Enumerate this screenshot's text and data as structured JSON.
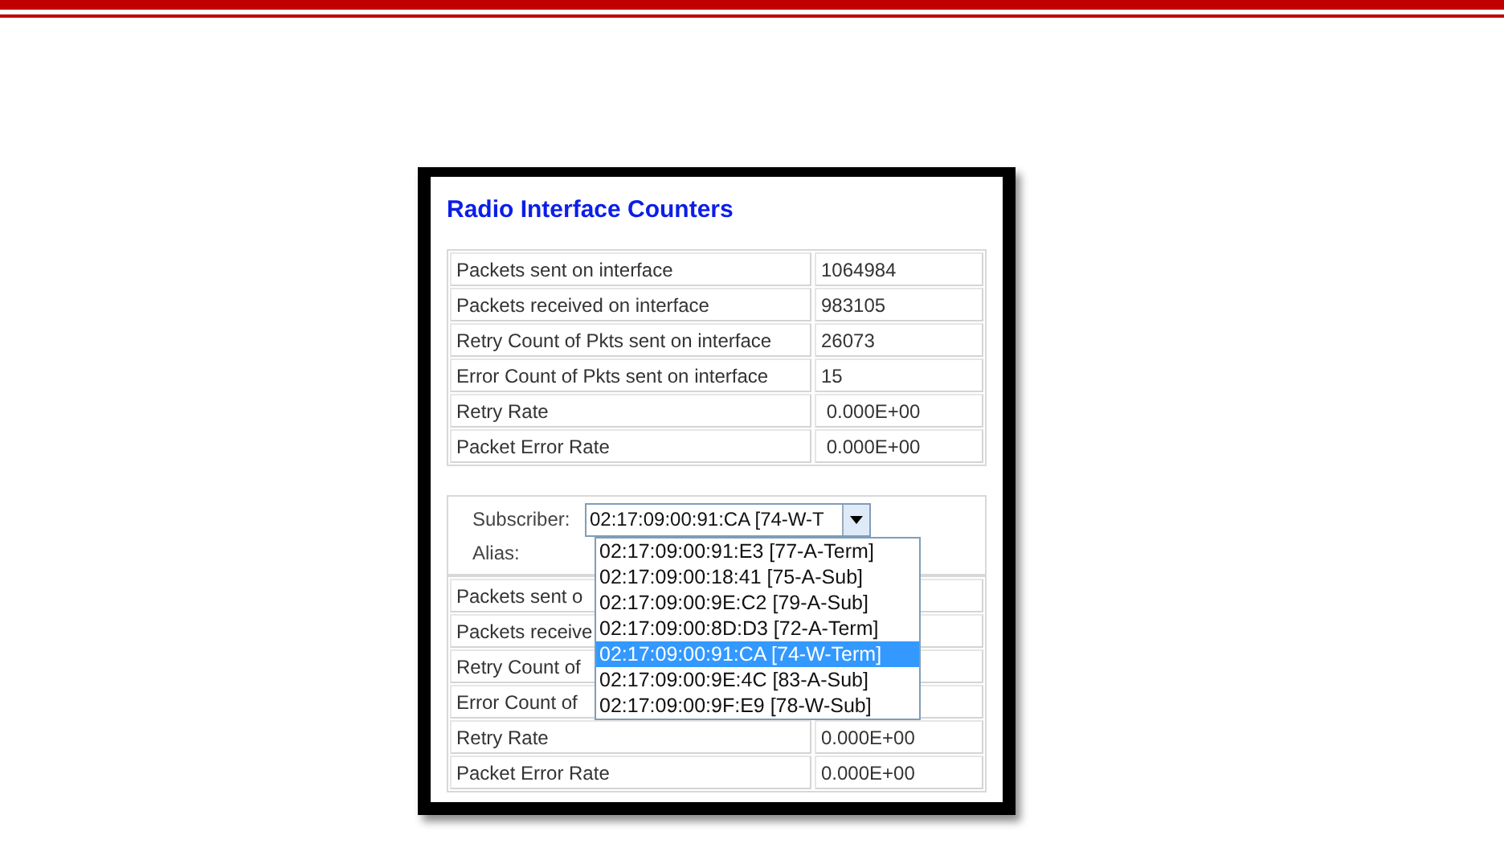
{
  "title": "Radio Interface Counters",
  "counters": [
    {
      "label": "Packets sent on interface",
      "value": "1064984"
    },
    {
      "label": "Packets received on interface",
      "value": "983105"
    },
    {
      "label": "Retry Count of Pkts sent on interface",
      "value": "26073"
    },
    {
      "label": "Error Count of Pkts sent on interface",
      "value": "15"
    },
    {
      "label": "Retry Rate",
      "value": " 0.000E+00"
    },
    {
      "label": "Packet Error Rate",
      "value": " 0.000E+00"
    }
  ],
  "subscriber": {
    "label": "Subscriber:",
    "value": "02:17:09:00:91:CA [74-W-T",
    "alias_label": "Alias:",
    "options": [
      {
        "label": "02:17:09:00:91:E3 [77-A-Term]",
        "selected": false
      },
      {
        "label": "02:17:09:00:18:41 [75-A-Sub]",
        "selected": false
      },
      {
        "label": "02:17:09:00:9E:C2 [79-A-Sub]",
        "selected": false
      },
      {
        "label": "02:17:09:00:8D:D3 [72-A-Term]",
        "selected": false
      },
      {
        "label": "02:17:09:00:91:CA [74-W-Term]",
        "selected": true
      },
      {
        "label": "02:17:09:00:9E:4C [83-A-Sub]",
        "selected": false
      },
      {
        "label": "02:17:09:00:9F:E9 [78-W-Sub]",
        "selected": false
      }
    ]
  },
  "subscriber_counters": [
    {
      "label": "Packets sent o"
    },
    {
      "label": "Packets receive"
    },
    {
      "label": "Retry Count of"
    },
    {
      "label": "Error Count of"
    },
    {
      "label": "Retry Rate",
      "value": "0.000E+00"
    },
    {
      "label": "Packet Error Rate",
      "value": "0.000E+00"
    }
  ]
}
